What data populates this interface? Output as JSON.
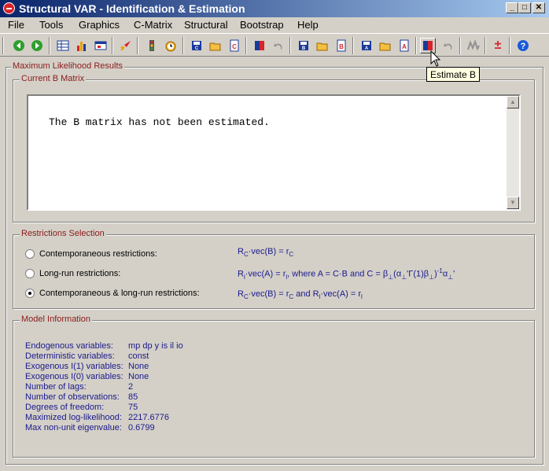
{
  "window": {
    "title": "Structural VAR - Identification & Estimation",
    "controls": {
      "minimize": "_",
      "maximize": "□",
      "close": "✕"
    }
  },
  "menu": [
    "File",
    "Tools",
    "Graphics",
    "C-Matrix",
    "Structural",
    "Bootstrap",
    "Help"
  ],
  "toolbar": {
    "icons": [
      "back-icon",
      "forward-icon",
      "table-icon",
      "bar-chart-icon",
      "window-icon",
      "rocket-icon",
      "traffic-light-icon",
      "alarm-clock-icon",
      "save-c-icon",
      "open-c-icon",
      "edit-c-icon",
      "estimate-c-icon",
      "undo-c-icon",
      "save-b-icon",
      "open-b-icon",
      "edit-b-icon",
      "save-a-icon",
      "open-a-icon",
      "edit-a-icon",
      "estimate-b-icon",
      "undo-b-icon",
      "impulse-icon",
      "plus-minus-icon",
      "help-icon"
    ],
    "plus_minus_glyph": "±",
    "help_glyph": "?",
    "tooltip": "Estimate B"
  },
  "results": {
    "group_title": "Maximum Likelihood Results",
    "matrix_group_title": "Current B Matrix",
    "matrix_text": "The B matrix has not been estimated."
  },
  "restrictions": {
    "group_title": "Restrictions Selection",
    "options": [
      {
        "label": "Contemporaneous restrictions:",
        "checked": false
      },
      {
        "label": "Long-run restrictions:",
        "checked": false
      },
      {
        "label": "Contemporaneous & long-run restrictions:",
        "checked": true
      }
    ]
  },
  "model_info": {
    "group_title": "Model Information",
    "rows": [
      {
        "label": "Endogenous variables:",
        "value": "mp dp y is il io"
      },
      {
        "label": "Deterministic variables:",
        "value": "const"
      },
      {
        "label": "Exogenous I(1) variables:",
        "value": "None"
      },
      {
        "label": "Exogenous I(0) variables:",
        "value": "None"
      },
      {
        "label": "Number of lags:",
        "value": "2"
      },
      {
        "label": "Number of observations:",
        "value": "85"
      },
      {
        "label": "Degrees of freedom:",
        "value": "75"
      },
      {
        "label": "Maximized log-likelihood:",
        "value": "2217.6776"
      },
      {
        "label": "Max non-unit eigenvalue:",
        "value": "0.6799"
      }
    ]
  }
}
